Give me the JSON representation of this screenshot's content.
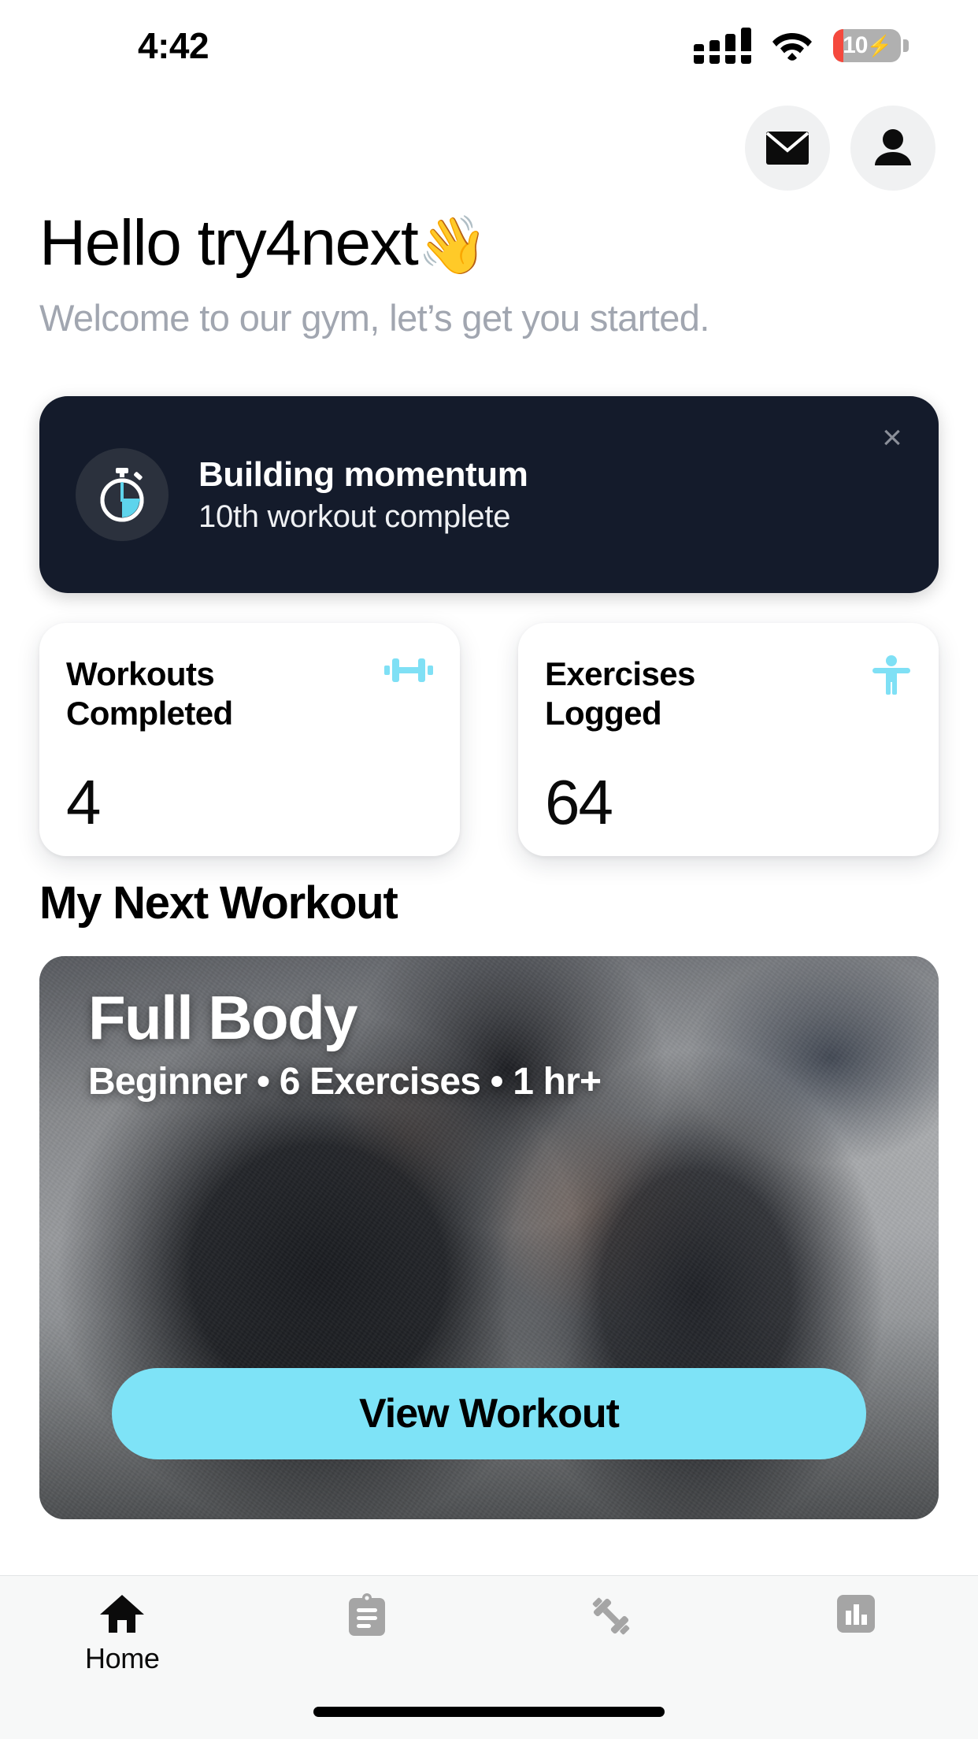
{
  "status_bar": {
    "time": "4:42",
    "battery_level": "10",
    "battery_charging": true,
    "battery_low_color": "#f5493d",
    "icons": [
      "cellular-signal-icon",
      "wifi-icon",
      "battery-icon"
    ]
  },
  "header": {
    "mail_icon": "mail-icon",
    "profile_icon": "profile-icon",
    "greeting": "Hello try4next",
    "greeting_emoji": "👋",
    "subtitle": "Welcome to our gym, let’s get you started."
  },
  "momentum_card": {
    "icon": "stopwatch-icon",
    "title": "Building momentum",
    "subtitle": "10th workout complete",
    "close_label": "×",
    "background": "#141b2b",
    "accent": "#4fd1e8"
  },
  "stats": [
    {
      "label": "Workouts Completed",
      "value": "4",
      "icon": "barbell-icon",
      "icon_color": "#7fe0f5"
    },
    {
      "label": "Exercises Logged",
      "value": "64",
      "icon": "person-exercise-icon",
      "icon_color": "#7fe0f5"
    }
  ],
  "next_workout": {
    "section_title": "My Next Workout",
    "title": "Full Body",
    "meta": "Beginner • 6 Exercises • 1 hr+",
    "button_label": "View Workout",
    "button_color": "#7ee3f7"
  },
  "tabbar": {
    "items": [
      {
        "label": "Home",
        "icon": "home-icon",
        "active": true
      },
      {
        "label": "",
        "icon": "clipboard-icon",
        "active": false
      },
      {
        "label": "",
        "icon": "dumbbell-icon",
        "active": false
      },
      {
        "label": "",
        "icon": "stats-bar-chart-icon",
        "active": false
      }
    ],
    "active_color": "#0b0b0b",
    "inactive_color": "#a0a0a0"
  }
}
